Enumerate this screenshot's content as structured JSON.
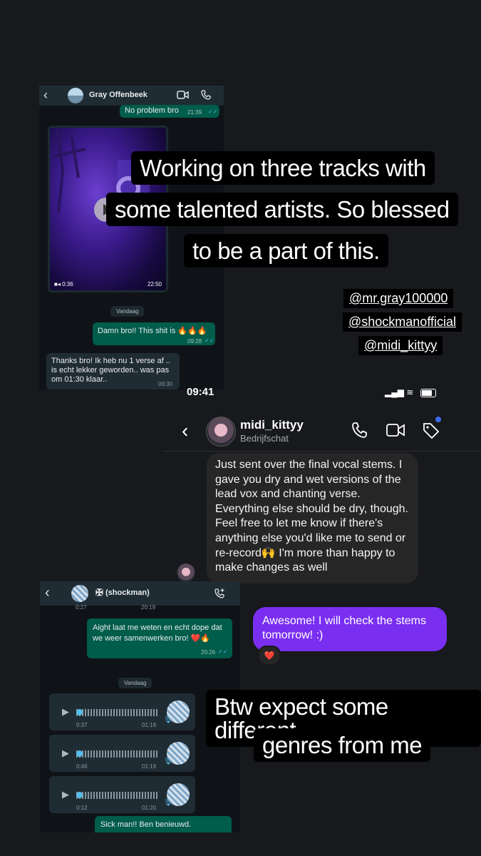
{
  "wa1": {
    "contact_name": "Gray Offenbeek",
    "messages": [
      {
        "text": "No problem bro",
        "time": "21:39"
      },
      {
        "text": "Damn bro!! This shit is 🔥🔥🔥",
        "time": "09:28"
      },
      {
        "text": "Thanks bro! Ik heb nu 1 verse af .. is echt lekker geworden.. was pas om 01:30 klaar..",
        "time": "09:30"
      }
    ],
    "video": {
      "duration": "0:36",
      "time": "22:50"
    },
    "day_chip": "Vandaag"
  },
  "caption": {
    "line1": "Working on three tracks with",
    "line2": "some talented artists. So blessed",
    "line3": "to be a part of this.",
    "bottom1": "Btw expect some different",
    "bottom2": "genres from me"
  },
  "mentions": [
    "@mr.gray100000",
    "@shockmanofficial",
    "@midi_kittyy"
  ],
  "ig": {
    "time": "09:41",
    "username": "midi_kittyy",
    "subtitle": "Bedrijfschat",
    "incoming": "Just sent over the final vocal stems. I gave you dry and wet versions of the lead vox and chanting verse. Everything else should be dry, though. Feel free to let me know if there's anything else you'd like me to send or re-record🙌 I'm more than happy to make changes as well",
    "outgoing": "Awesome! I will check the stems tomorrow! :)",
    "reaction": "❤️"
  },
  "wa2": {
    "contact_name": "(shockman)",
    "top_time_left": "0:27",
    "top_time_right": "20:19",
    "message": "Aight laat me weten en echt dope dat we weer samenwerken bro! ❤️🔥",
    "message_time": "20:26",
    "day_chip": "Vandaag",
    "voice_notes": [
      {
        "duration": "0:37",
        "time": "01:18"
      },
      {
        "duration": "0:46",
        "time": "01:19"
      },
      {
        "duration": "0:12",
        "time": "01:20"
      }
    ],
    "last_message": "Sick man!! Ben benieuwd."
  },
  "colors": {
    "ig_purple": "#7a2ff0",
    "wa_green": "#005c4b",
    "wa_header": "#1f2c33"
  }
}
